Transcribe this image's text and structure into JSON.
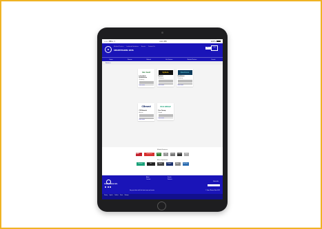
{
  "status": {
    "carrier": "•••• BELL ≑",
    "time": "4:21 PM",
    "battery": "100%"
  },
  "header": {
    "logo_text": "B",
    "top_links": [
      "Medical Devices",
      "Industrial Solutions",
      "Events",
      "Contact Us"
    ],
    "brand": "SMARTPHARMA DATA",
    "signin": "Sign in",
    "cart": "Cart",
    "nav": [
      "Home",
      "Pharma",
      "Biotech",
      "Life Science",
      "Medical Devices",
      "Events"
    ]
  },
  "breadcrumb": "Partners",
  "cards": [
    {
      "logo": "lion beat",
      "logo_color": "#2a7a3a",
      "title": "Lion Beat Healthcare",
      "sub": "Germany",
      "more": "Learn more"
    },
    {
      "logo": "hytera",
      "logo_color": "#f0c419",
      "title": "Hytera",
      "sub": "Germany",
      "more": "Learn more"
    },
    {
      "logo": "Qualicare",
      "logo_color": "#56b6c9",
      "title": "Qualicare",
      "sub": "Germany",
      "more": "Learn more"
    },
    {
      "logo": "CBmed",
      "logo_color": "#1a2f6b",
      "title": "CB Biotech",
      "sub": "Austria",
      "more": "Learn more"
    },
    {
      "logo": "ECO OPOLE",
      "logo_color": "#1aa179",
      "title": "Eco Group",
      "sub": "Poland",
      "more": "Learn more"
    }
  ],
  "strip1": {
    "title": "Media Partners",
    "logos": [
      "Pharma Health",
      "Top Pharma",
      "Biotech",
      "Lab",
      "MedTech",
      "BioWorld",
      "iStem"
    ]
  },
  "strip2": {
    "title": "Silver Sponsors",
    "logos": [
      "Siemens",
      "Lion",
      "Hytera",
      "Cytogen",
      "Bayer",
      "Next Gen"
    ]
  },
  "footer": {
    "brand": "SMARTPHARMA DATA",
    "cols": [
      "About",
      "Contact",
      "Events",
      "Partners"
    ],
    "newsletter": "Subscribe",
    "notice": "Stay up to date with the latest news and events",
    "copyright": "© Smart Pharma Data 2023",
    "bottom_links": [
      "Privacy",
      "Imprint",
      "Cookies",
      "Terms",
      "Sitemap"
    ]
  }
}
